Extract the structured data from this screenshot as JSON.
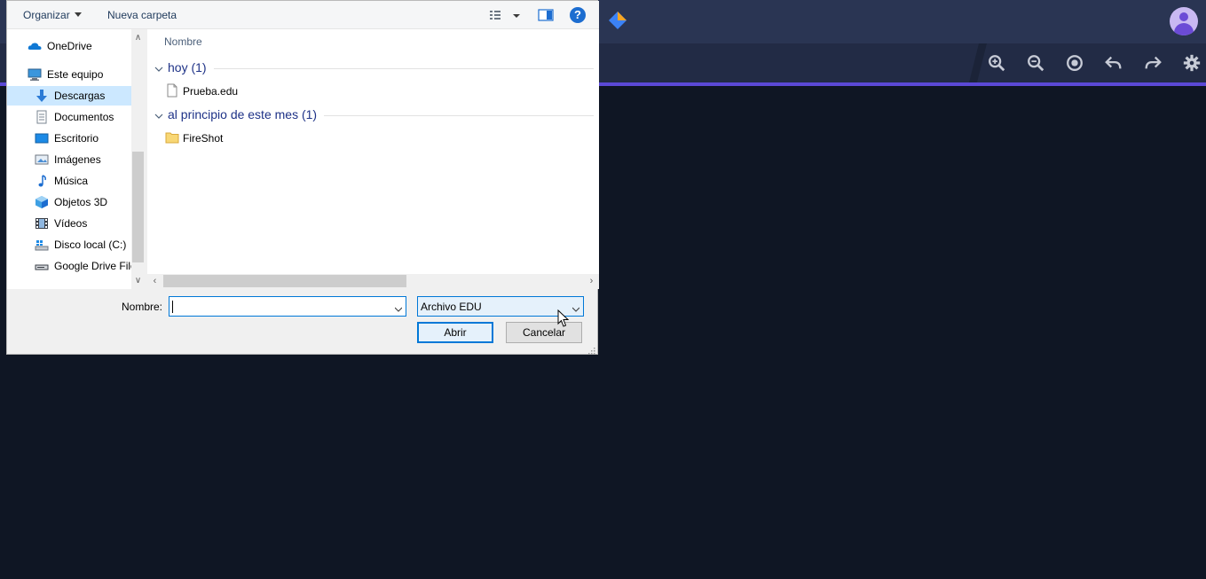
{
  "dialog": {
    "toolbar": {
      "organize_label": "Organizar",
      "new_folder_label": "Nueva carpeta",
      "view_icon": "view-options-icon",
      "preview_icon": "preview-pane-icon",
      "help_label": "?"
    },
    "nav": {
      "items": [
        {
          "label": "OneDrive",
          "icon": "onedrive-icon"
        },
        {
          "label": "Este equipo",
          "icon": "computer-icon"
        },
        {
          "label": "Descargas",
          "icon": "downloads-icon",
          "selected": true
        },
        {
          "label": "Documentos",
          "icon": "documents-icon"
        },
        {
          "label": "Escritorio",
          "icon": "desktop-icon"
        },
        {
          "label": "Imágenes",
          "icon": "pictures-icon"
        },
        {
          "label": "Música",
          "icon": "music-icon"
        },
        {
          "label": "Objetos 3D",
          "icon": "objects3d-icon"
        },
        {
          "label": "Vídeos",
          "icon": "videos-icon"
        },
        {
          "label": "Disco local (C:)",
          "icon": "local-disk-icon"
        },
        {
          "label": "Google Drive File",
          "icon": "drive-icon"
        }
      ]
    },
    "filelist": {
      "column_header": "Nombre",
      "groups": [
        {
          "title": "hoy (1)",
          "files": [
            {
              "name": "Prueba.edu",
              "icon": "file-icon"
            }
          ]
        },
        {
          "title": "al principio de este mes (1)",
          "files": [
            {
              "name": "FireShot",
              "icon": "folder-icon"
            }
          ]
        }
      ]
    },
    "bottom": {
      "name_label": "Nombre:",
      "name_value": "",
      "file_type": "Archivo EDU",
      "open_label": "Abrir",
      "cancel_label": "Cancelar"
    }
  },
  "app": {
    "accent_color": "#5b49d6",
    "background_color": "#0f1624",
    "tools": [
      "zoom-in-icon",
      "zoom-out-icon",
      "target-icon",
      "undo-icon",
      "redo-icon",
      "settings-icon"
    ]
  }
}
